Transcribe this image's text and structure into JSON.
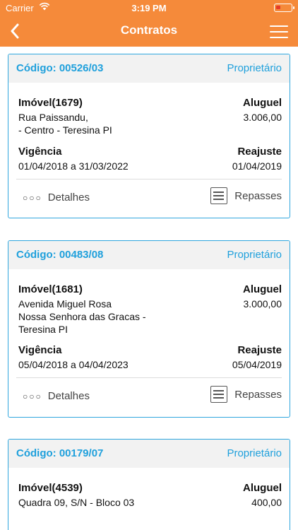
{
  "status_bar": {
    "carrier": "Carrier",
    "time": "3:19 PM"
  },
  "nav": {
    "title": "Contratos"
  },
  "contracts": [
    {
      "code": "Código: 00526/03",
      "role": "Proprietário",
      "property_label": "Imóvel(1679)",
      "address_lines": [
        "Rua Paissandu,",
        "- Centro - Teresina PI"
      ],
      "rent_label": "Aluguel",
      "rent_value": "3.006,00",
      "term_label": "Vigência",
      "term_value": "01/04/2018 a 31/03/2022",
      "adjust_label": "Reajuste",
      "adjust_value": "01/04/2019",
      "details_label": "Detalhes",
      "transfers_label": "Repasses"
    },
    {
      "code": "Código: 00483/08",
      "role": "Proprietário",
      "property_label": "Imóvel(1681)",
      "address_lines": [
        "Avenida Miguel Rosa",
        "Nossa Senhora das Gracas -",
        "Teresina PI"
      ],
      "rent_label": "Aluguel",
      "rent_value": "3.000,00",
      "term_label": "Vigência",
      "term_value": "05/04/2018 a 04/04/2023",
      "adjust_label": "Reajuste",
      "adjust_value": "05/04/2019",
      "details_label": "Detalhes",
      "transfers_label": "Repasses"
    },
    {
      "code": "Código: 00179/07",
      "role": "Proprietário",
      "property_label": "Imóvel(4539)",
      "address_lines": [
        "Quadra 09, S/N - Bloco 03"
      ],
      "rent_label": "Aluguel",
      "rent_value": "400,00"
    }
  ]
}
